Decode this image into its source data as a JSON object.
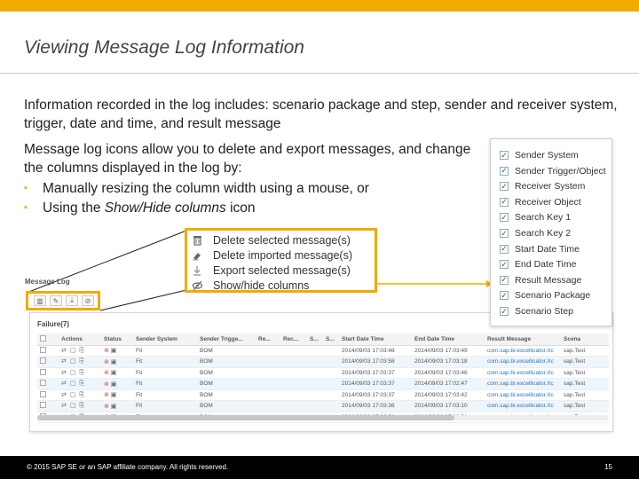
{
  "slide": {
    "title": "Viewing Message Log Information",
    "para1": "Information recorded in the log includes: scenario package and step, sender and receiver system, trigger, date and time, and result message",
    "para2": "Message log icons allow you to delete and export messages, and change the columns displayed in the log by:",
    "bullet1": "Manually resizing the column width using a mouse, or",
    "bullet2_prefix": "Using the ",
    "bullet2_italic": "Show/Hide columns",
    "bullet2_suffix": " icon"
  },
  "legend": [
    {
      "icon": "trash-icon",
      "label": "Delete selected message(s)"
    },
    {
      "icon": "eraser-icon",
      "label": "Delete imported message(s)"
    },
    {
      "icon": "download-icon",
      "label": "Export selected message(s)"
    },
    {
      "icon": "eye-slash-icon",
      "label": "Show/hide columns"
    }
  ],
  "log": {
    "label": "Message Log",
    "group": "Failure(7)",
    "columns": [
      "",
      "Actions",
      "Status",
      "Sender System",
      "Sender Trigge...",
      "Re...",
      "Rec...",
      "S...",
      "S...",
      "Start Date Time",
      "End Date Time",
      "Result Message",
      "Scena"
    ],
    "rows": [
      [
        "Fit",
        "BOM",
        "2014/09/03 17:03:48",
        "2014/09/03 17:03:49",
        "com.sap.bi.excellicator.Xc",
        "sap.Test"
      ],
      [
        "Fit",
        "BOM",
        "2014/09/03 17:03:58",
        "2014/09/03 17:03:18",
        "com.sap.bi.excellicator.Xc",
        "sap.Test"
      ],
      [
        "Fit",
        "BOM",
        "2014/09/03 17:03:37",
        "2014/09/03 17:03:46",
        "com.sap.bi.excellicator.Xc",
        "sap.Test"
      ],
      [
        "Fit",
        "BOM",
        "2014/09/03 17:03:37",
        "2014/09/03 17:02:47",
        "com.sap.bi.excellicator.Xc",
        "sap.Test"
      ],
      [
        "Fit",
        "BOM",
        "2014/09/03 17:03:37",
        "2014/09/03 17:03:42",
        "com.sap.bi.excellicator.Xc",
        "sap.Test"
      ],
      [
        "Fit",
        "BOM",
        "2014/09/03 17:03:36",
        "2014/09/03 17:03:10",
        "com.sap.bi.excellicator.Xc",
        "sap.Test"
      ],
      [
        "Fit",
        "BOM",
        "2014/09/02 17:03:58",
        "2014/09/02 17:03:58",
        "com.sap.bi.excellicator.Xc",
        "sap.Test"
      ]
    ]
  },
  "column_popup": {
    "items": [
      "Sender System",
      "Sender Trigger/Object",
      "Receiver System",
      "Receiver Object",
      "Search Key 1",
      "Search Key 2",
      "Start Date Time",
      "End Date Time",
      "Result Message",
      "Scenario Package",
      "Scenario Step"
    ]
  },
  "footer": {
    "copyright": "© 2015 SAP SE or an SAP affiliate company. All rights reserved.",
    "page": "15"
  },
  "colors": {
    "accent": "#f0ab00",
    "footer_bg": "#000000",
    "link": "#2b74b6",
    "error": "#d9534f"
  }
}
